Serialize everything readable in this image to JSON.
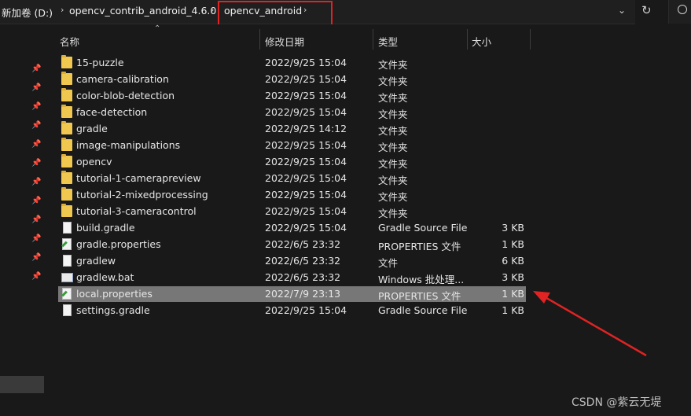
{
  "address": {
    "crumbs": [
      "新加卷 (D:)",
      "opencv_contrib_android_4.6.0",
      "opencv_android"
    ],
    "separator": "›"
  },
  "columns": {
    "name": "名称",
    "modified": "修改日期",
    "type": "类型",
    "size": "大小"
  },
  "files": [
    {
      "name": "15-puzzle",
      "modified": "2022/9/25 15:04",
      "type": "文件夹",
      "size": "",
      "icon": "folder-icon"
    },
    {
      "name": "camera-calibration",
      "modified": "2022/9/25 15:04",
      "type": "文件夹",
      "size": "",
      "icon": "folder-icon"
    },
    {
      "name": "color-blob-detection",
      "modified": "2022/9/25 15:04",
      "type": "文件夹",
      "size": "",
      "icon": "folder-icon"
    },
    {
      "name": "face-detection",
      "modified": "2022/9/25 15:04",
      "type": "文件夹",
      "size": "",
      "icon": "folder-icon"
    },
    {
      "name": "gradle",
      "modified": "2022/9/25 14:12",
      "type": "文件夹",
      "size": "",
      "icon": "folder-icon"
    },
    {
      "name": "image-manipulations",
      "modified": "2022/9/25 15:04",
      "type": "文件夹",
      "size": "",
      "icon": "folder-icon"
    },
    {
      "name": "opencv",
      "modified": "2022/9/25 15:04",
      "type": "文件夹",
      "size": "",
      "icon": "folder-icon"
    },
    {
      "name": "tutorial-1-camerapreview",
      "modified": "2022/9/25 15:04",
      "type": "文件夹",
      "size": "",
      "icon": "folder-icon"
    },
    {
      "name": "tutorial-2-mixedprocessing",
      "modified": "2022/9/25 15:04",
      "type": "文件夹",
      "size": "",
      "icon": "folder-icon"
    },
    {
      "name": "tutorial-3-cameracontrol",
      "modified": "2022/9/25 15:04",
      "type": "文件夹",
      "size": "",
      "icon": "folder-icon"
    },
    {
      "name": "build.gradle",
      "modified": "2022/9/25 15:04",
      "type": "Gradle Source File",
      "size": "3 KB",
      "icon": "file-icon"
    },
    {
      "name": "gradle.properties",
      "modified": "2022/6/5 23:32",
      "type": "PROPERTIES 文件",
      "size": "1 KB",
      "icon": "properties-file-icon"
    },
    {
      "name": "gradlew",
      "modified": "2022/6/5 23:32",
      "type": "文件",
      "size": "6 KB",
      "icon": "file-icon"
    },
    {
      "name": "gradlew.bat",
      "modified": "2022/6/5 23:32",
      "type": "Windows 批处理...",
      "size": "3 KB",
      "icon": "batch-file-icon"
    },
    {
      "name": "local.properties",
      "modified": "2022/7/9 23:13",
      "type": "PROPERTIES 文件",
      "size": "1 KB",
      "icon": "properties-file-icon",
      "selected": true
    },
    {
      "name": "settings.gradle",
      "modified": "2022/9/25 15:04",
      "type": "Gradle Source File",
      "size": "1 KB",
      "icon": "file-icon"
    }
  ],
  "watermark": "CSDN @紫云无堤",
  "colors": {
    "annotation": "#e02323",
    "selected_row": "#777777",
    "folder": "#f0c850"
  }
}
